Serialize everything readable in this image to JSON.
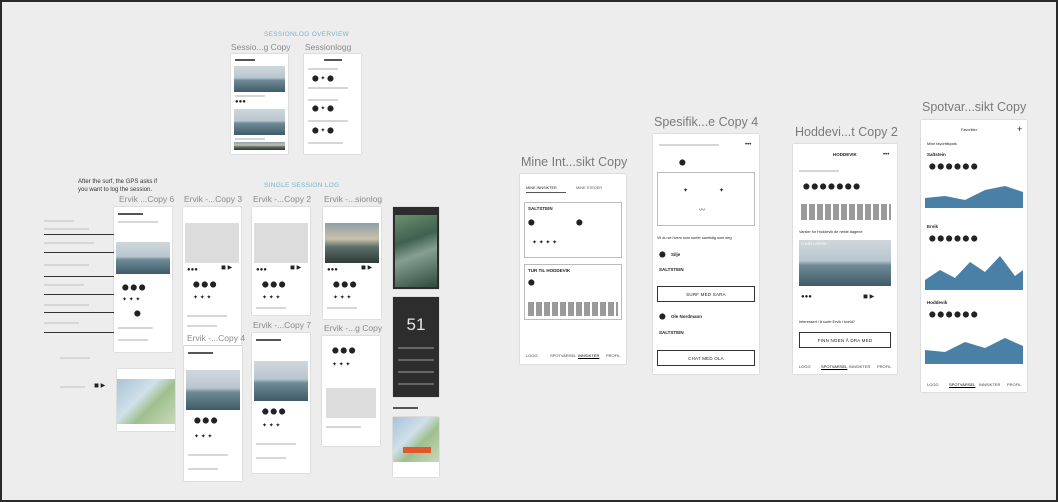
{
  "sections": {
    "sessionlog_overview": "SESSIONLOG OVERVIEW",
    "single_session_log": "SINGLE  SESSION LOG"
  },
  "artboards": {
    "sessio_g_copy": "Sessio...g Copy",
    "sessionlogg": "Sessionlogg",
    "ervik_copy6": "Ervik  ...Copy 6",
    "ervik_copy3": "Ervik -...Copy 3",
    "ervik_copy2": "Ervik -...Copy 2",
    "ervik_sionlog": "Ervik -...sionlog",
    "ervik_copy4": "Ervik -...Copy 4",
    "ervik_copy7": "Ervik -...Copy 7",
    "ervik_g_copy": "Ervik -...g Copy",
    "mine_int": "Mine Int...sikt Copy",
    "spesifik": "Spesifik...e Copy 4",
    "hoddevi": "Hoddevi...t Copy 2",
    "spotvar": "Spotvar...sikt Copy"
  },
  "annotation": {
    "line1": "After the surf, the GPS asks if",
    "line2": "you want to log the session."
  },
  "mine_int_screen": {
    "tab1": "MINE INNSIKTER",
    "tab2": "MINE STEDER",
    "card1_title": "SALTSTEIN",
    "card2_title": "TUR TIL HODDEVIK",
    "nav": [
      "LOGG",
      "SPOTVARSEL",
      "INNSIKTER",
      "PROFIL"
    ]
  },
  "spesifik_screen": {
    "question": "Vil du se hvem som surfer samtidig som deg",
    "person1": "Silje",
    "spot1": "SALTSTEIN",
    "btn1": "SURF MED SARA",
    "person2": "Ole Nordmann",
    "spot2": "SALTSTEIN",
    "btn2": "CHAT MED OLA"
  },
  "hoddevi_screen": {
    "header": "HODDEVIK",
    "section": "Varsler for Hoddevik de neste dagene",
    "photo_caption": "LUNELI ERVIK",
    "cta_text": "Interessert i å surfe Ervik i kveld?",
    "cta_btn": "FINN NOEN Å DRA MED",
    "nav": [
      "LOGG",
      "SPOTVARSEL",
      "INNSIKTER",
      "PROFIL"
    ]
  },
  "spotvar_screen": {
    "header": "Favoritter",
    "sub": "Mine favorittspots",
    "spot1": "Saltstein",
    "spot2": "Ervik",
    "spot3": "Hoddevik",
    "nav": [
      "LOGG",
      "SPOTVARSEL",
      "INNSIKTER",
      "PROFIL"
    ]
  },
  "dark_screen": {
    "big_number": "51"
  }
}
